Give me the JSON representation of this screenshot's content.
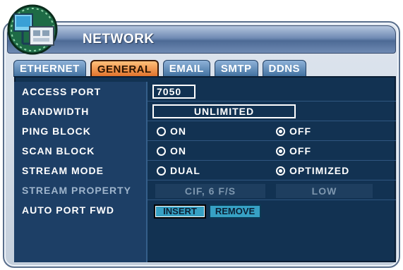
{
  "window": {
    "title": "NETWORK"
  },
  "tabs": [
    {
      "label": "ETHERNET"
    },
    {
      "label": "GENERAL",
      "active": true
    },
    {
      "label": "EMAIL"
    },
    {
      "label": "SMTP"
    },
    {
      "label": "DDNS"
    }
  ],
  "rows": {
    "access_port": {
      "label": "ACCESS PORT",
      "value": "7050"
    },
    "bandwidth": {
      "label": "BANDWIDTH",
      "value": "UNLIMITED"
    },
    "ping_block": {
      "label": "PING BLOCK",
      "opt_a": "ON",
      "opt_b": "OFF",
      "selected": "OFF"
    },
    "scan_block": {
      "label": "SCAN BLOCK",
      "opt_a": "ON",
      "opt_b": "OFF",
      "selected": "OFF"
    },
    "stream_mode": {
      "label": "STREAM MODE",
      "opt_a": "DUAL",
      "opt_b": "OPTIMIZED",
      "selected": "OPTIMIZED"
    },
    "stream_property": {
      "label": "STREAM PROPERTY",
      "value_a": "CIF, 6 F/S",
      "value_b": "LOW"
    },
    "auto_port_fwd": {
      "label": "AUTO PORT FWD",
      "insert": "INSERT",
      "remove": "REMOVE"
    }
  },
  "colors": {
    "panel_bg": "#123252",
    "label_bg": "#1d3f66",
    "active_tab": "#e0702a",
    "tab": "#3f6f9e",
    "button": "#37a1c4"
  },
  "icons": {
    "window_icon": "network-computer-icon"
  }
}
